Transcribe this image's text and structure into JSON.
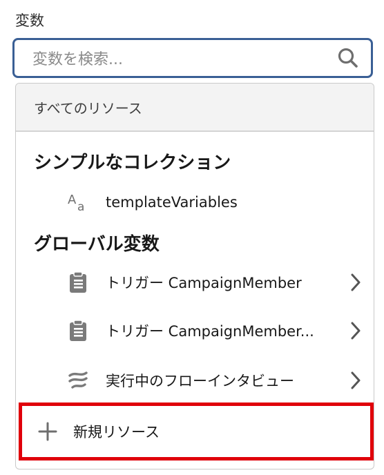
{
  "field": {
    "label": "変数"
  },
  "search": {
    "placeholder": "変数を検索...",
    "icon": "search-icon"
  },
  "dropdown": {
    "all_resources": "すべてのリソース",
    "sections": [
      {
        "heading": "シンプルなコレクション",
        "items": [
          {
            "label": "templateVariables",
            "icon": "text-type-icon",
            "has_chevron": false
          }
        ]
      },
      {
        "heading": "グローバル変数",
        "items": [
          {
            "label": "トリガー CampaignMember",
            "icon": "clipboard-icon",
            "has_chevron": true
          },
          {
            "label": "トリガー CampaignMember...",
            "icon": "clipboard-icon",
            "has_chevron": true
          },
          {
            "label": "実行中のフローインタビュー",
            "icon": "flow-icon",
            "has_chevron": true
          }
        ]
      }
    ],
    "new_resource": {
      "label": "新規リソース",
      "icon": "plus-icon"
    }
  },
  "colors": {
    "focus_border": "#3a5f95",
    "highlight_border": "#e0000a",
    "icon_gray": "#7a7a7a"
  }
}
